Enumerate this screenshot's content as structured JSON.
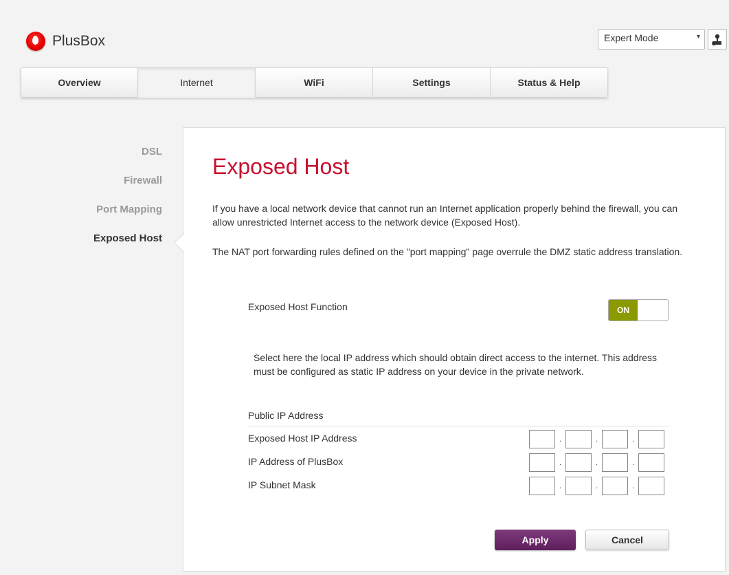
{
  "header": {
    "brand": "PlusBox",
    "mode_select": {
      "value": "Expert Mode",
      "icon": "chevron-down-icon"
    },
    "user_icon": "user-icon"
  },
  "tabs": [
    {
      "label": "Overview",
      "active": false
    },
    {
      "label": "Internet",
      "active": true
    },
    {
      "label": "WiFi",
      "active": false
    },
    {
      "label": "Settings",
      "active": false
    },
    {
      "label": "Status & Help",
      "active": false
    }
  ],
  "sidebar": {
    "items": [
      {
        "label": "DSL",
        "active": false
      },
      {
        "label": "Firewall",
        "active": false
      },
      {
        "label": "Port Mapping",
        "active": false
      },
      {
        "label": "Exposed Host",
        "active": true
      }
    ]
  },
  "main": {
    "title": "Exposed Host",
    "intro1": "If you have a local network device that cannot run an Internet application properly behind the firewall, you can allow unrestricted Internet access to the network device (Exposed Host).",
    "intro2": "The NAT port forwarding rules defined on the \"port mapping\" page overrule the DMZ static address translation.",
    "function_label": "Exposed Host Function",
    "toggle_state": "ON",
    "select_description": "Select here the local IP address which should obtain direct access to the internet. This address must be configured as static IP address on your device in the private network.",
    "public_ip_label": "Public IP Address",
    "rows": [
      {
        "label": "Exposed Host IP Address",
        "octets": [
          "",
          "",
          "",
          ""
        ]
      },
      {
        "label": "IP Address of PlusBox",
        "octets": [
          "",
          "",
          "",
          ""
        ]
      },
      {
        "label": "IP Subnet Mask",
        "octets": [
          "",
          "",
          "",
          ""
        ]
      }
    ],
    "apply_label": "Apply",
    "cancel_label": "Cancel"
  },
  "colors": {
    "title": "#c8102e",
    "toggle_on": "#8a9a00",
    "apply": "#6b2a69",
    "brand": "#e60000"
  }
}
